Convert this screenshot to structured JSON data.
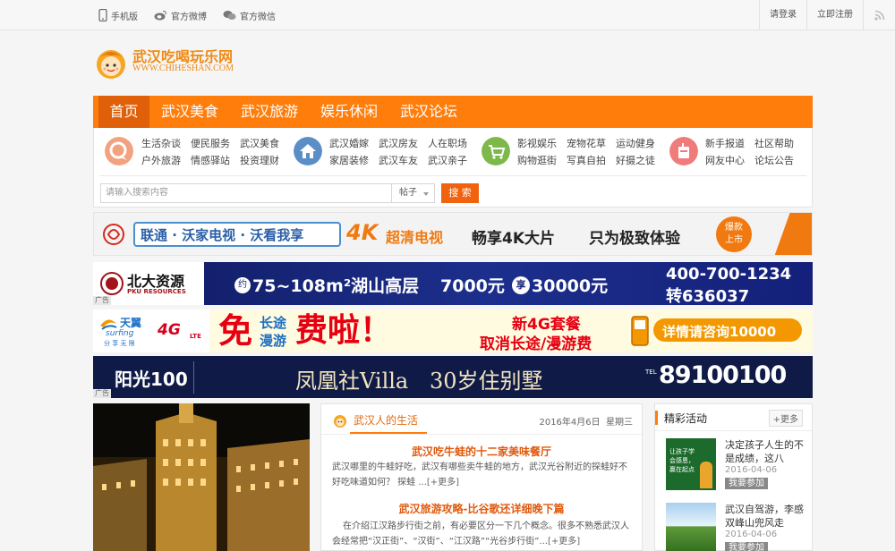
{
  "topbar": {
    "mobile": "手机版",
    "weibo": "官方微博",
    "weixin": "官方微信",
    "login": "请登录",
    "register": "立即注册"
  },
  "logo": {
    "name_cn": "武汉吃喝玩乐网",
    "name_en": "WWW.CHIHESHAN.COM"
  },
  "nav": [
    "首页",
    "武汉美食",
    "武汉旅游",
    "娱乐休闲",
    "武汉论坛"
  ],
  "subnav": {
    "group1": [
      "生活杂谈",
      "便民服务",
      "武汉美食",
      "户外旅游",
      "情感驿站",
      "投资理财"
    ],
    "group2": [
      "武汉婚嫁",
      "武汉房友",
      "人在职场",
      "家居装修",
      "武汉车友",
      "武汉亲子"
    ],
    "group3": [
      "影视娱乐",
      "宠物花草",
      "运动健身",
      "购物逛街",
      "写真自拍",
      "好摄之徒"
    ],
    "group4": [
      "新手报道",
      "社区帮助",
      "网友中心",
      "论坛公告"
    ]
  },
  "search": {
    "placeholder": "请输入搜索内容",
    "type": "帖子",
    "button": "搜 索"
  },
  "ads": {
    "ad1": {
      "slogan": "联通 · 沃家电视 · 沃看我享",
      "k4": "4K",
      "hd": "超清电视",
      "enjoy": "畅享4K大片",
      "ultimate": "只为极致体验",
      "badge": "爆款上市"
    },
    "ad2": {
      "brand_cn": "北大资源",
      "brand_en": "PKU RESOURCES",
      "pre": "约",
      "area": "75~108m²湖山高层",
      "price": "7000元",
      "save": "享",
      "discount": "30000元",
      "phone1": "400-700-1234",
      "phone2": "转636037",
      "tag": "广告"
    },
    "ad3": {
      "brand": "天翼",
      "brand_en": "surfing",
      "brand_sub": "分 享 无 限",
      "g4": "4G",
      "lte": "LTE",
      "free": "免",
      "longdist": "长途",
      "roaming": "漫游",
      "fee": "费啦！",
      "pkg": "新4G套餐",
      "cancel": "取消长途/漫游费",
      "consult": "详情请咨询10000"
    },
    "ad4": {
      "brand": "阳光100",
      "title": "凤凰社Villa",
      "sub": "30岁住别墅",
      "tel_label": "TEL",
      "tel": "89100100",
      "tag": "广告"
    }
  },
  "article_box": {
    "title": "武汉人的生活",
    "date": "2016年4月6日  星期三",
    "articles": [
      {
        "title": "武汉吃牛蛙的十二家美味餐厅",
        "body": "武汉哪里的牛蛙好吃，武汉有哪些卖牛蛙的地方，武汉光谷附近的探蛙好不好吃味道如何？ 探蛙 ...",
        "more": "[+更多]"
      },
      {
        "title": "武汉旅游攻略-比谷歌还详细晚下篇",
        "body": "在介绍江汉路步行街之前，有必要区分一下几个概念。很多不熟悉武汉人会经常把“汉正街”、“汉街”、“江汉路”“光谷步行街”...",
        "more": "[+更多]"
      }
    ]
  },
  "side": {
    "title": "精彩活动",
    "more": "+更多",
    "items": [
      {
        "text": "决定孩子人生的不是成绩，这八",
        "date": "2016-04-06",
        "join": "我要参加",
        "thumb": "让孩子学会感恩，赢在起点"
      },
      {
        "text": "武汉自驾游，李感双峰山兜风走",
        "date": "2016-04-06",
        "join": "我要参加"
      }
    ]
  }
}
